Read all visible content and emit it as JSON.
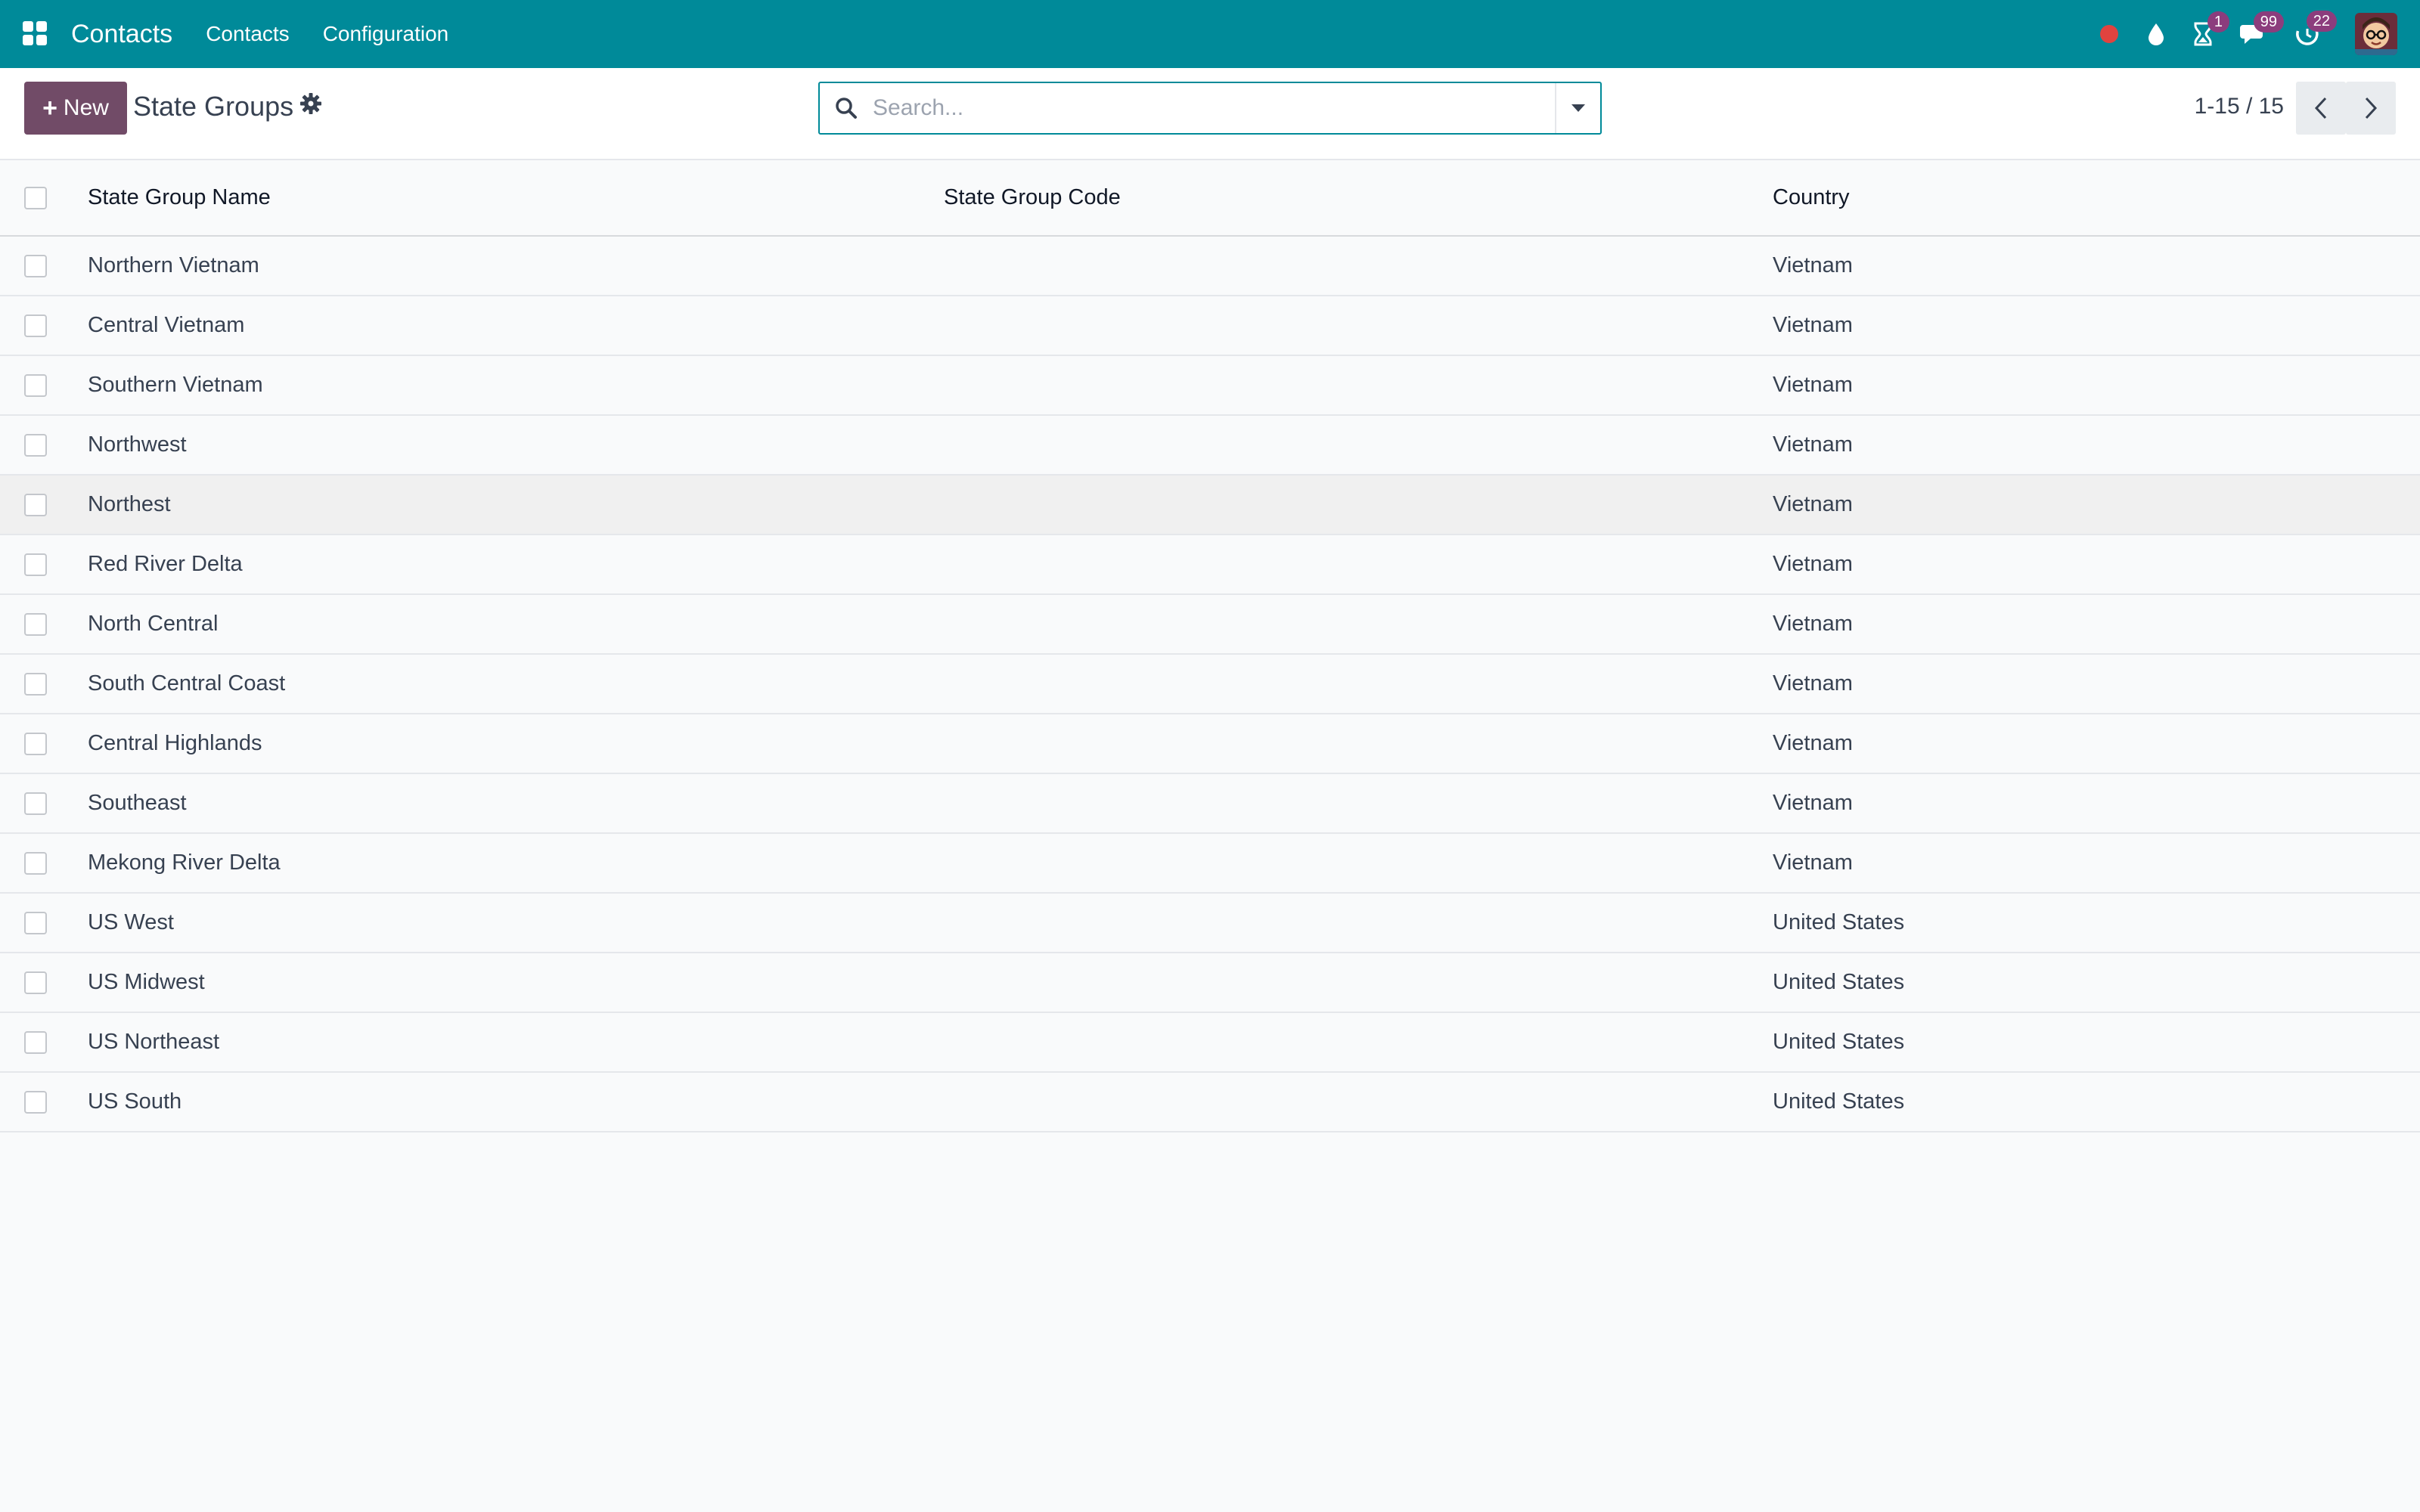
{
  "navbar": {
    "brand": "Contacts",
    "menu": [
      {
        "label": "Contacts"
      },
      {
        "label": "Configuration"
      }
    ],
    "systray": {
      "activity_count": "1",
      "messages_count": "99",
      "updates_count": "22"
    }
  },
  "control_panel": {
    "new_label": "New",
    "title": "State Groups",
    "search_placeholder": "Search...",
    "pager": "1-15 / 15"
  },
  "table": {
    "columns": [
      "State Group Name",
      "State Group Code",
      "Country"
    ],
    "rows": [
      {
        "name": "Northern Vietnam",
        "code": "",
        "country": "Vietnam"
      },
      {
        "name": "Central Vietnam",
        "code": "",
        "country": "Vietnam"
      },
      {
        "name": "Southern Vietnam",
        "code": "",
        "country": "Vietnam"
      },
      {
        "name": "Northwest",
        "code": "",
        "country": "Vietnam"
      },
      {
        "name": "Northest",
        "code": "",
        "country": "Vietnam"
      },
      {
        "name": "Red River Delta",
        "code": "",
        "country": "Vietnam"
      },
      {
        "name": "North Central",
        "code": "",
        "country": "Vietnam"
      },
      {
        "name": "South Central Coast",
        "code": "",
        "country": "Vietnam"
      },
      {
        "name": "Central Highlands",
        "code": "",
        "country": "Vietnam"
      },
      {
        "name": "Southeast",
        "code": "",
        "country": "Vietnam"
      },
      {
        "name": "Mekong River Delta",
        "code": "",
        "country": "Vietnam"
      },
      {
        "name": "US West",
        "code": "",
        "country": "United States"
      },
      {
        "name": "US Midwest",
        "code": "",
        "country": "United States"
      },
      {
        "name": "US Northeast",
        "code": "",
        "country": "United States"
      },
      {
        "name": "US South",
        "code": "",
        "country": "United States"
      }
    ]
  },
  "colors": {
    "navbar": "#008a99",
    "primary_button": "#714b67",
    "badge": "#8c3d7d",
    "recording_dot": "#e0433f"
  },
  "icons": [
    "apps-grid-icon",
    "record-dot-icon",
    "drop-icon",
    "hourglass-icon",
    "chat-icon",
    "clock-refresh-icon",
    "gear-icon",
    "search-icon",
    "caret-down-icon",
    "chevron-left-icon",
    "chevron-right-icon"
  ]
}
